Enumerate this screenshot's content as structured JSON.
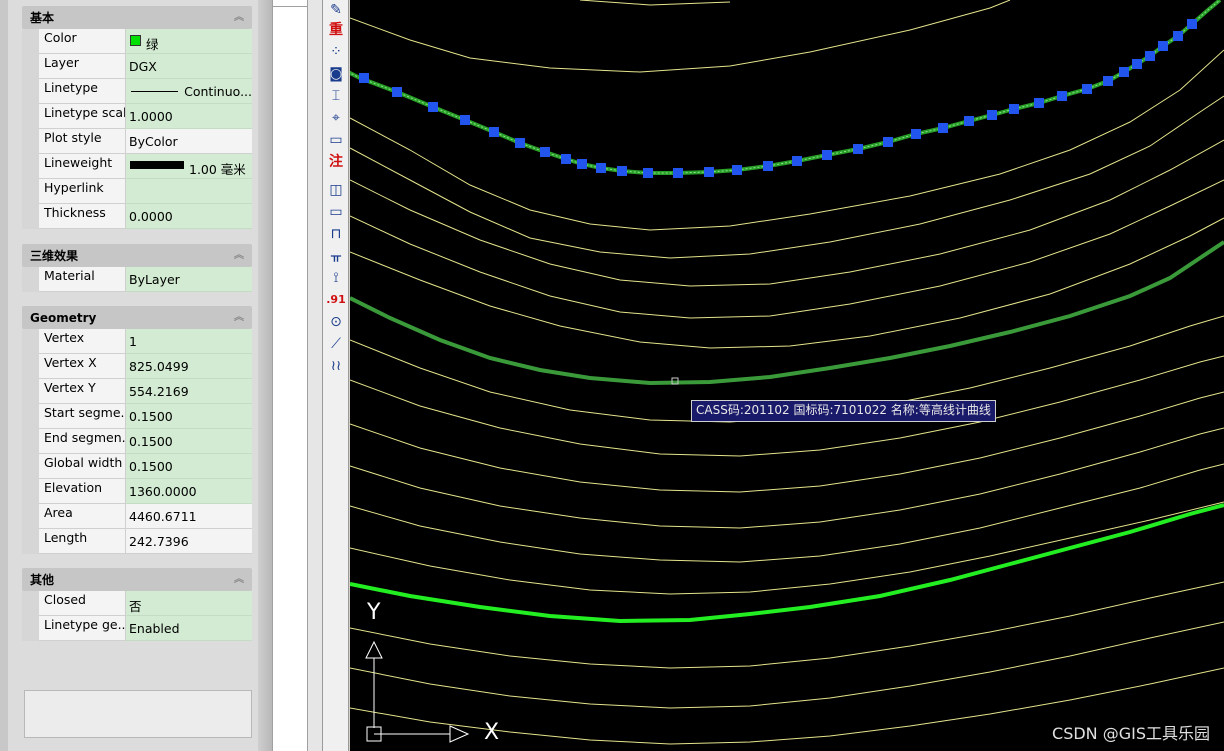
{
  "properties": {
    "sections": [
      {
        "title": "基本",
        "rows": [
          {
            "name": "Color",
            "value": "绿",
            "kind": "color",
            "color": "#00e000"
          },
          {
            "name": "Layer",
            "value": "DGX"
          },
          {
            "name": "Linetype",
            "value": "Continuo...",
            "kind": "linetype"
          },
          {
            "name": "Linetype scale",
            "value": "1.0000"
          },
          {
            "name": "Plot style",
            "value": "ByColor",
            "readonly": true
          },
          {
            "name": "Lineweight",
            "value": "1.00 毫米",
            "kind": "lineweight"
          },
          {
            "name": "Hyperlink",
            "value": ""
          },
          {
            "name": "Thickness",
            "value": "0.0000"
          }
        ]
      },
      {
        "title": "三维效果",
        "rows": [
          {
            "name": "Material",
            "value": "ByLayer"
          }
        ]
      },
      {
        "title": "Geometry",
        "rows": [
          {
            "name": "Vertex",
            "value": "1"
          },
          {
            "name": "Vertex X",
            "value": "825.0499"
          },
          {
            "name": "Vertex Y",
            "value": "554.2169"
          },
          {
            "name": "Start segme...",
            "value": "0.1500"
          },
          {
            "name": "End segmen...",
            "value": "0.1500"
          },
          {
            "name": "Global width",
            "value": "0.1500"
          },
          {
            "name": "Elevation",
            "value": "1360.0000"
          },
          {
            "name": "Area",
            "value": "4460.6711",
            "readonly": true
          },
          {
            "name": "Length",
            "value": "242.7396",
            "readonly": true
          }
        ]
      },
      {
        "title": "其他",
        "rows": [
          {
            "name": "Closed",
            "value": "否"
          },
          {
            "name": "Linetype ge...",
            "value": "Enabled"
          }
        ]
      }
    ]
  },
  "toolbar": {
    "icons": [
      {
        "name": "pen-edit-icon",
        "glyph": "✎"
      },
      {
        "name": "zhong-text-icon",
        "glyph": "重",
        "red": true
      },
      {
        "name": "grid-points-icon",
        "glyph": "⁘"
      },
      {
        "name": "layer-view-icon",
        "glyph": "◙"
      },
      {
        "name": "dimension-icon",
        "glyph": "⌶"
      },
      {
        "name": "measure-icon",
        "glyph": "⌖"
      },
      {
        "name": "ruler-icon",
        "glyph": "▭"
      },
      {
        "name": "zhu-annotation-icon",
        "glyph": "注",
        "red": true
      },
      {
        "name": "polygon-icon",
        "glyph": "◫"
      },
      {
        "name": "rectangle-icon",
        "glyph": "▭"
      },
      {
        "name": "bridge-icon",
        "glyph": "⊓"
      },
      {
        "name": "fence-icon",
        "glyph": "ᚂ"
      },
      {
        "name": "route-icon",
        "glyph": "⟟"
      },
      {
        "name": "elevation-point-icon",
        "glyph": ".91",
        "red": true
      },
      {
        "name": "circle-point-icon",
        "glyph": "⊙"
      },
      {
        "name": "line-segment-icon",
        "glyph": "⟋"
      },
      {
        "name": "wave-lines-icon",
        "glyph": "≀≀"
      }
    ]
  },
  "canvas": {
    "tooltip": "CASS码:201102 国标码:7101022 名称:等高线计曲线",
    "axis_x": "X",
    "axis_y": "Y",
    "watermark": "CSDN @GIS工具乐园",
    "colors": {
      "background": "#000000",
      "contour": "#e4e48c",
      "selected": "#28a028",
      "grip": "#2255ee",
      "index_contour": "#22ee22"
    }
  }
}
